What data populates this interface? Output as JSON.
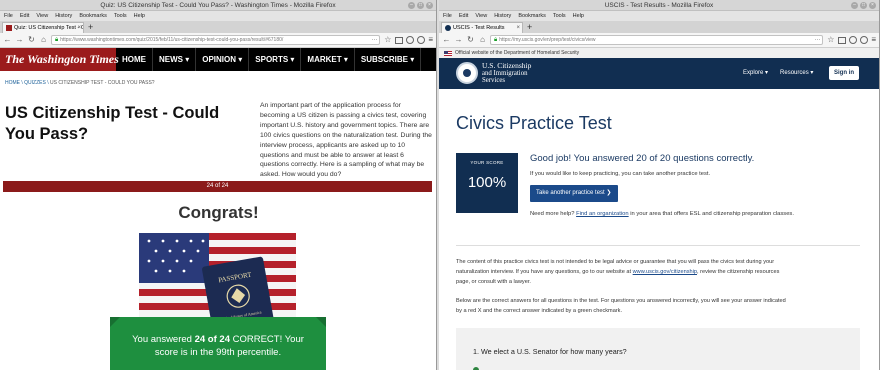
{
  "left_window": {
    "title": "Quiz: US Citizenship Test - Could You Pass? - Washington Times - Mozilla Firefox",
    "menu": [
      "File",
      "Edit",
      "View",
      "History",
      "Bookmarks",
      "Tools",
      "Help"
    ],
    "tab_label": "Quiz: US Citizenship Test - C",
    "url": "https://www.washingtontimes.com/quiz/2015/feb/11/us-citizenship-test-could-you-pass/result/#67180/",
    "site": {
      "logo": "The Washington Times",
      "nav": [
        "HOME",
        "NEWS ▾",
        "OPINION ▾",
        "SPORTS ▾",
        "MARKET ▾",
        "SUBSCRIBE ▾"
      ],
      "breadcrumb": [
        "HOME",
        "QUIZZES",
        "US CITIZENSHIP TEST - COULD YOU PASS?"
      ],
      "title": "US Citizenship Test - Could You Pass?",
      "intro": "An important part of the application process for becoming a US citizen is passing a civics test, covering important U.S. history and government topics. There are 100 civics questions on the naturalization test. During the interview process, applicants are asked up to 10 questions and must be able to answer at least 6 questions correctly. Here is a sampling of what may be asked. How would you do?",
      "progress_label": "24 of 24",
      "congrats": "Congrats!",
      "passport_text": "PASSPORT",
      "passport_subtext": "United States of America",
      "result_prefix": "You answered ",
      "result_bold": "24 of 24",
      "result_suffix": " CORRECT! Your score is in the 99th percentile."
    }
  },
  "right_window": {
    "title": "USCIS - Test Results - Mozilla Firefox",
    "menu": [
      "File",
      "Edit",
      "View",
      "History",
      "Bookmarks",
      "Tools",
      "Help"
    ],
    "tab_label": "USCIS - Test Results",
    "url": "https://my.uscis.gov/en/prep/test/civics/view",
    "site": {
      "gov_banner": "Official website of the Department of Homeland Security",
      "brand": [
        "U.S. Citizenship",
        "and Immigration",
        "Services"
      ],
      "nav": [
        "Explore ▾",
        "Resources ▾"
      ],
      "signin": "Sign in",
      "title": "Civics Practice Test",
      "score_label": "YOUR SCORE",
      "score_value": "100%",
      "good_job": "Good job! You answered 20 of 20 questions correctly.",
      "keep_practicing": "If you would like to keep practicing, you can take another practice test.",
      "take_another": "Take another practice test ❯",
      "more_help_prefix": "Need more help? ",
      "more_help_link": "Find an organization",
      "more_help_suffix": " in your area that offers ESL and citizenship preparation classes.",
      "disclaimer_prefix": "The content of this practice civics test is not intended to be legal advice or guarantee that you will pass the civics test during your naturalization interview. If you have any questions, go to our website at ",
      "disclaimer_link": "www.uscis.gov/citizenship",
      "disclaimer_suffix": ", review the citizenship resources page, or consult with a lawyer.",
      "answers_intro": "Below are the correct answers for all questions in the test. For questions you answered incorrectly, you will see your answer indicated by a red X and the correct answer indicated by a green checkmark.",
      "question_1": "1. We elect a U.S. Senator for how many years?"
    }
  },
  "colors": {
    "wt_red": "#9b1b1c",
    "wt_green": "#1e8f3f",
    "uscis_navy": "#112e51",
    "uscis_button": "#1b4a8a"
  }
}
